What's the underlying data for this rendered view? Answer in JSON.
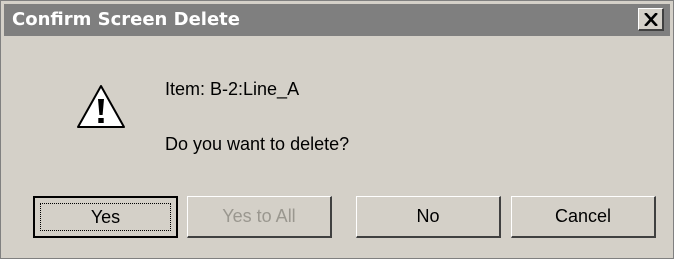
{
  "dialog": {
    "title": "Confirm Screen Delete",
    "icon": "warning-icon",
    "message": {
      "item_line": "Item: B-2:Line_A",
      "question": "Do you want to delete?"
    },
    "buttons": {
      "yes": "Yes",
      "yes_to_all": "Yes to All",
      "no": "No",
      "cancel": "Cancel"
    }
  },
  "colors": {
    "dialog_background": "#d4d0c8",
    "titlebar_background": "#7f7f7f",
    "titlebar_text": "#ffffff",
    "disabled_text": "#9a978f"
  }
}
